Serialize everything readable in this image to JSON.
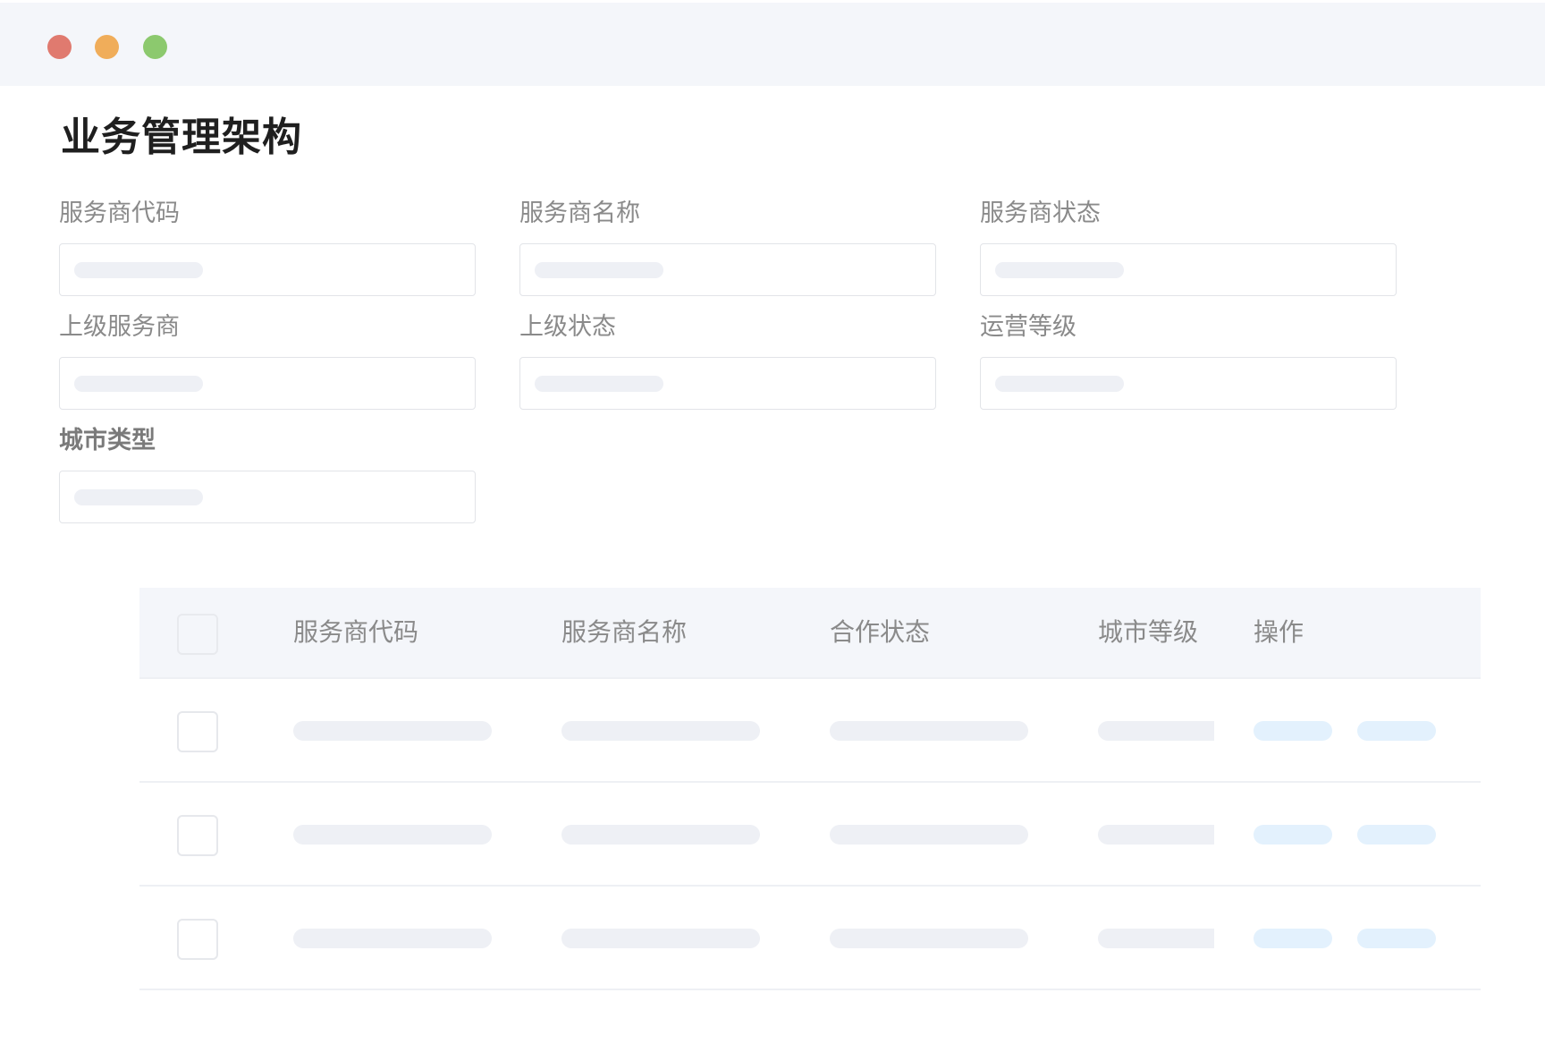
{
  "window": {
    "traffic_lights": [
      {
        "name": "close",
        "color": "#e07a6f"
      },
      {
        "name": "minimize",
        "color": "#f0ad5a"
      },
      {
        "name": "maximize",
        "color": "#8cc96e"
      }
    ]
  },
  "page": {
    "title": "业务管理架构"
  },
  "form": {
    "fields": [
      {
        "label": "服务商代码"
      },
      {
        "label": "服务商名称"
      },
      {
        "label": "服务商状态"
      },
      {
        "label": "上级服务商"
      },
      {
        "label": "上级状态"
      },
      {
        "label": "运营等级"
      },
      {
        "label": "城市类型"
      }
    ]
  },
  "table": {
    "columns": [
      "服务商代码",
      "服务商名称",
      "合作状态",
      "城市等级",
      "操作"
    ],
    "row_count": 3
  },
  "colors": {
    "skeleton": "#eef0f5",
    "action_skeleton": "#e3f1fd",
    "titlebar": "#f4f6fa",
    "header_bg": "#f4f6fa"
  }
}
